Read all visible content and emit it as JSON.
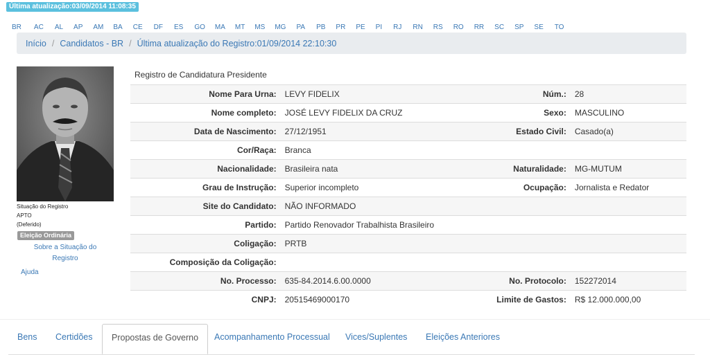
{
  "update_badge": "Última atualização:03/09/2014 11:08:35",
  "states": [
    "BR",
    "AC",
    "AL",
    "AP",
    "AM",
    "BA",
    "CE",
    "DF",
    "ES",
    "GO",
    "MA",
    "MT",
    "MS",
    "MG",
    "PA",
    "PB",
    "PR",
    "PE",
    "PI",
    "RJ",
    "RN",
    "RS",
    "RO",
    "RR",
    "SC",
    "SP",
    "SE",
    "TO"
  ],
  "breadcrumb": {
    "home": "Início",
    "candidates": "Candidatos - BR",
    "last_update": "Última atualização do Registro:01/09/2014 22:10:30",
    "separator": "/"
  },
  "sidebar": {
    "situation_label": "Situação do Registro",
    "situation_value": "APTO",
    "situation_detail": "(Deferido)",
    "election_badge": "Eleição Ordinária",
    "about_link": "Sobre a Situação do Registro",
    "help_link": "Ajuda"
  },
  "registration_title": "Registro de Candidatura Presidente",
  "fields": {
    "ballot_name": {
      "label": "Nome Para Urna:",
      "value": "LEVY FIDELIX"
    },
    "number": {
      "label": "Núm.:",
      "value": "28"
    },
    "full_name": {
      "label": "Nome completo:",
      "value": "JOSÉ LEVY FIDELIX DA CRUZ"
    },
    "sex": {
      "label": "Sexo:",
      "value": "MASCULINO"
    },
    "birth_date": {
      "label": "Data de Nascimento:",
      "value": "27/12/1951"
    },
    "marital_status": {
      "label": "Estado Civil:",
      "value": "Casado(a)"
    },
    "race": {
      "label": "Cor/Raça:",
      "value": "Branca"
    },
    "nationality": {
      "label": "Nacionalidade:",
      "value": "Brasileira nata"
    },
    "birthplace": {
      "label": "Naturalidade:",
      "value": "MG-MUTUM"
    },
    "education": {
      "label": "Grau de Instrução:",
      "value": "Superior incompleto"
    },
    "occupation": {
      "label": "Ocupação:",
      "value": "Jornalista e Redator"
    },
    "website": {
      "label": "Site do Candidato:",
      "value": "NÃO INFORMADO"
    },
    "party": {
      "label": "Partido:",
      "value": "Partido Renovador Trabalhista Brasileiro"
    },
    "coalition": {
      "label": "Coligação:",
      "value": "PRTB"
    },
    "coalition_composition": {
      "label": "Composição da Coligação:",
      "value": ""
    },
    "process_number": {
      "label": "No. Processo:",
      "value": "635-84.2014.6.00.0000"
    },
    "protocol_number": {
      "label": "No. Protocolo:",
      "value": "152272014"
    },
    "cnpj": {
      "label": "CNPJ:",
      "value": "20515469000170"
    },
    "spending_limit": {
      "label": "Limite de Gastos:",
      "value": "R$ 12.000.000,00"
    }
  },
  "tabs": [
    "Bens",
    "Certidões",
    "Propostas de Governo",
    "Acompanhamento Processual",
    "Vices/Suplentes",
    "Eleições Anteriores"
  ],
  "colors": {
    "link": "#3a78b5",
    "update_badge": "#5bc0de",
    "election_badge": "#999999",
    "breadcrumb_bg": "#e9ecef"
  }
}
